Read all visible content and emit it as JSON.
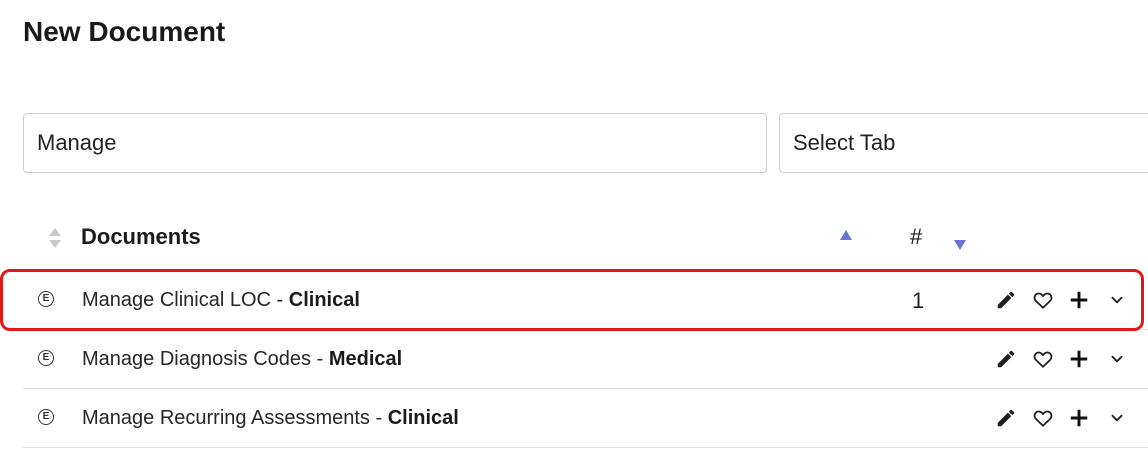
{
  "page": {
    "title": "New Document"
  },
  "search": {
    "value": "Manage"
  },
  "tab_select": {
    "selected": "Select Tab"
  },
  "table": {
    "headers": {
      "documents": "Documents",
      "count": "#"
    },
    "rows": [
      {
        "name": "Manage Clinical LOC",
        "separator": " - ",
        "category": "Clinical",
        "count": "1",
        "highlighted": true
      },
      {
        "name": "Manage Diagnosis Codes",
        "separator": " - ",
        "category": "Medical",
        "count": "",
        "highlighted": false
      },
      {
        "name": "Manage Recurring Assessments",
        "separator": " - ",
        "category": "Clinical",
        "count": "",
        "highlighted": false
      }
    ],
    "row_icon_letter": "E"
  },
  "icons": {
    "row_type": "e-circle-icon",
    "edit": "pencil-icon",
    "favorite": "heart-icon",
    "add": "plus-icon",
    "expand": "chevron-down-icon",
    "sort_both": "sort-icon",
    "sort_asc": "sort-up-icon",
    "sort_desc": "sort-down-icon"
  },
  "colors": {
    "highlight": "#e01818",
    "sort_active": "#6b74d6",
    "sort_inactive": "#c8c8c8"
  }
}
